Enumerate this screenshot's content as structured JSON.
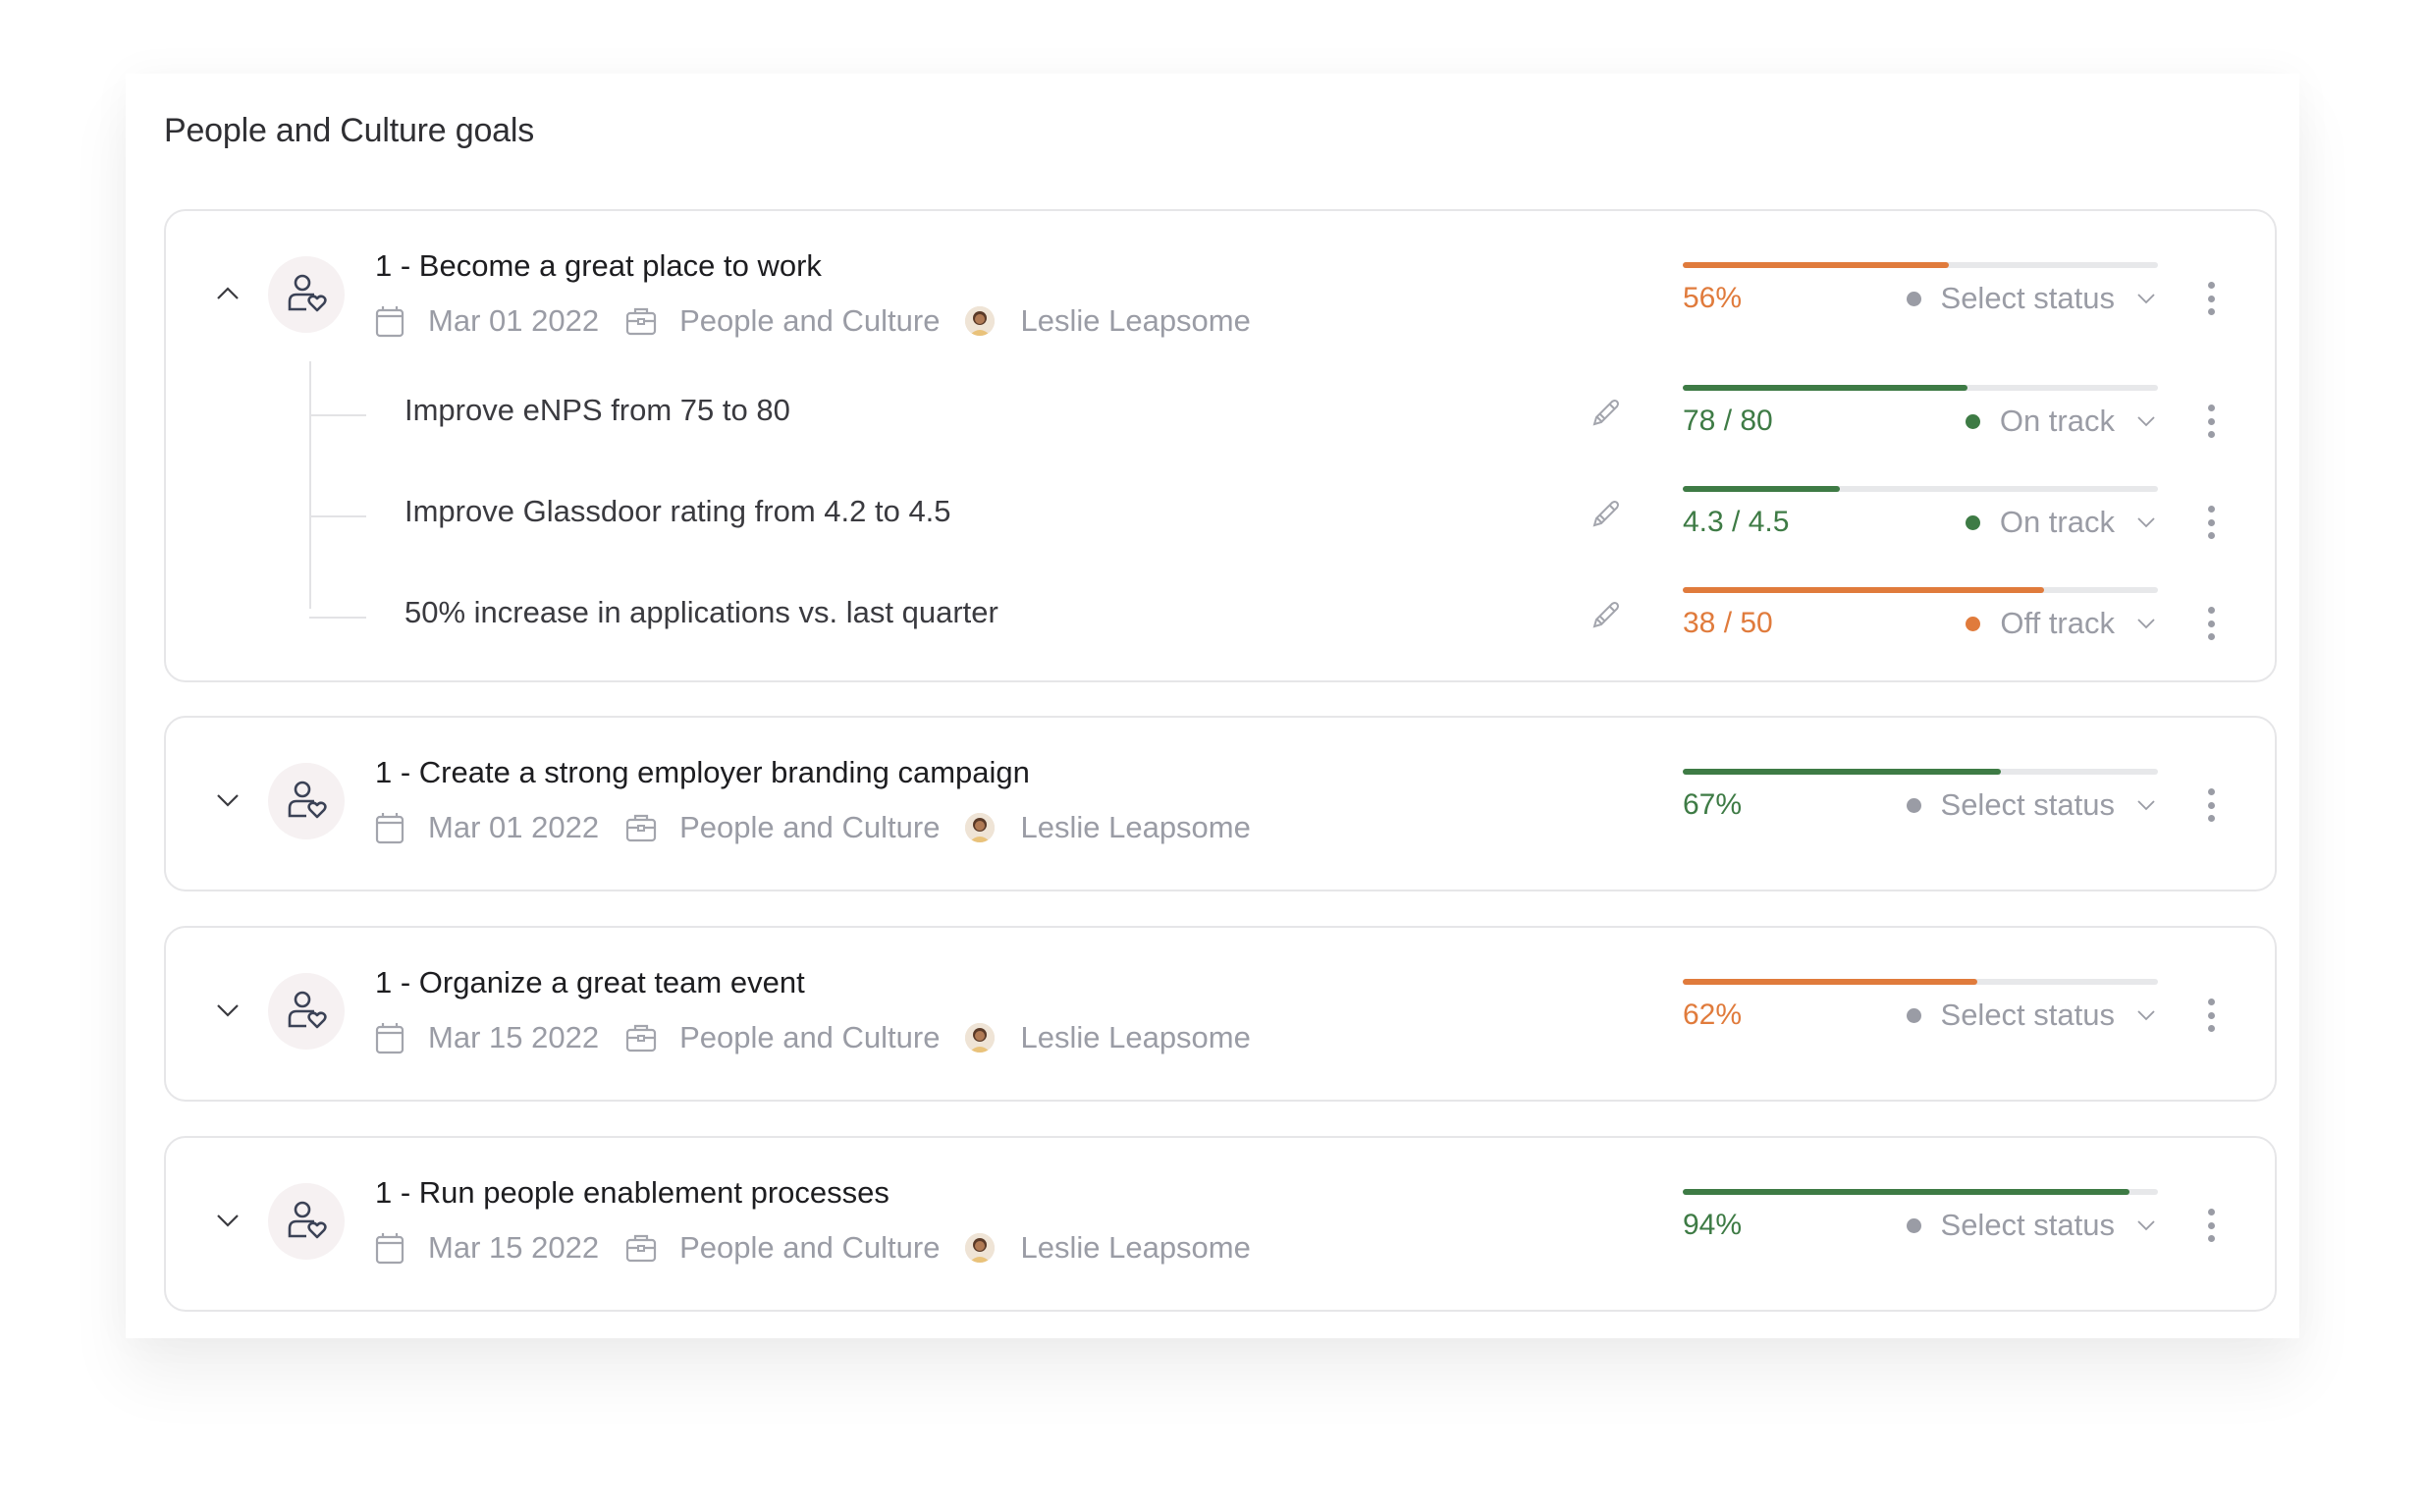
{
  "page": {
    "title": "People and Culture goals"
  },
  "colors": {
    "orange": "#e07b3c",
    "green": "#3e7b45",
    "grey": "#9a9ca5",
    "track": "#e7e8ea"
  },
  "goals": [
    {
      "title": "1 - Become a great place to work",
      "expanded": true,
      "date": "Mar 01 2022",
      "team": "People and Culture",
      "owner": "Leslie Leapsome",
      "progress_label": "56%",
      "progress": 0.56,
      "progress_color": "orange",
      "status": "Select status",
      "key_results": [
        {
          "title": "Improve eNPS from 75 to 80",
          "value_label": "78 / 80",
          "progress": 0.6,
          "color": "green",
          "status": "On track"
        },
        {
          "title": "Improve Glassdoor rating from 4.2 to 4.5",
          "value_label": "4.3 / 4.5",
          "progress": 0.33,
          "color": "green",
          "status": "On track"
        },
        {
          "title": "50% increase in applications vs. last quarter",
          "value_label": "38 / 50",
          "progress": 0.76,
          "color": "orange",
          "status": "Off track"
        }
      ]
    },
    {
      "title": "1 - Create a strong employer branding campaign",
      "expanded": false,
      "date": "Mar 01 2022",
      "team": "People and Culture",
      "owner": "Leslie Leapsome",
      "progress_label": "67%",
      "progress": 0.67,
      "progress_color": "green",
      "status": "Select status"
    },
    {
      "title": "1 - Organize a great team event",
      "expanded": false,
      "date": "Mar 15 2022",
      "team": "People and Culture",
      "owner": "Leslie Leapsome",
      "progress_label": "62%",
      "progress": 0.62,
      "progress_color": "orange",
      "status": "Select status"
    },
    {
      "title": "1 - Run people enablement processes",
      "expanded": false,
      "date": "Mar 15 2022",
      "team": "People and Culture",
      "owner": "Leslie Leapsome",
      "progress_label": "94%",
      "progress": 0.94,
      "progress_color": "green",
      "status": "Select status"
    }
  ],
  "icons": {
    "expand": "chevron-up-icon",
    "collapse": "chevron-down-icon",
    "goal": "person-heart-icon",
    "date": "calendar-icon",
    "team": "briefcase-icon",
    "owner": "avatar",
    "edit": "pencil-icon",
    "menu": "kebab-menu-icon"
  }
}
